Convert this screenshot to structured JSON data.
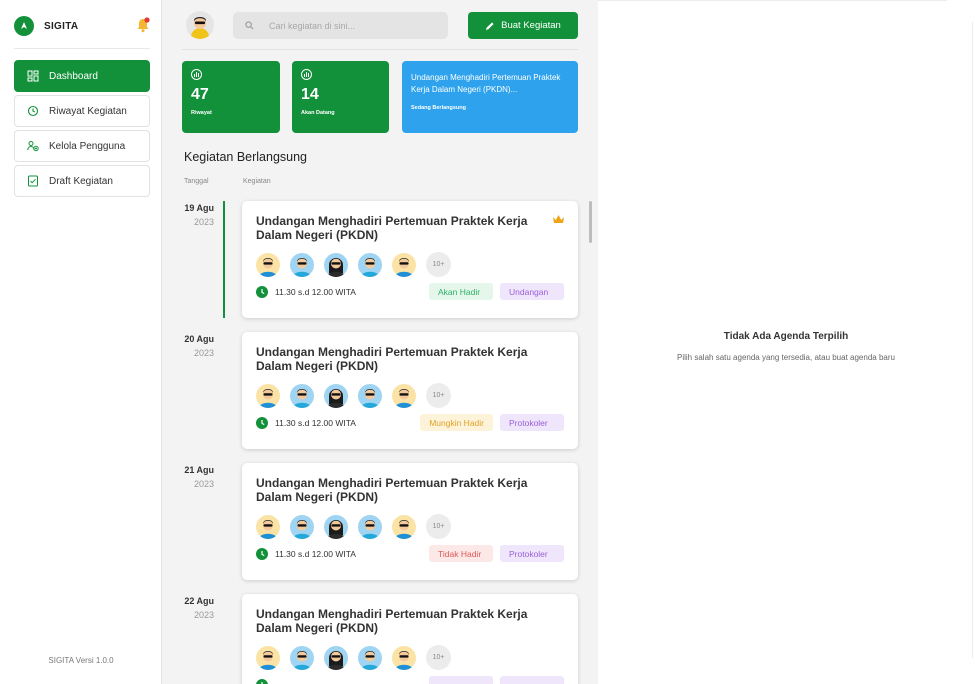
{
  "app": {
    "name": "SIGITA",
    "version_label": "SIGITA Versi 1.0.0"
  },
  "sidebar": {
    "items": [
      {
        "label": "Dashboard",
        "icon": "dashboard-icon",
        "active": true
      },
      {
        "label": "Riwayat Kegiatan",
        "icon": "history-icon",
        "active": false
      },
      {
        "label": "Kelola Pengguna",
        "icon": "users-icon",
        "active": false
      },
      {
        "label": "Draft Kegiatan",
        "icon": "draft-icon",
        "active": false
      }
    ]
  },
  "header": {
    "search_placeholder": "Cari kegiatan di sini...",
    "create_button": "Buat Kegiatan"
  },
  "stats": {
    "history": {
      "value": "47",
      "label": "Riwayat"
    },
    "upcoming": {
      "value": "14",
      "label": "Akan Datang"
    },
    "ongoing": {
      "title": "Undangan Menghadiri Pertemuan Praktek Kerja Dalam Negeri (PKDN)...",
      "label": "Sedang Berlangsung"
    }
  },
  "section": {
    "title": "Kegiatan Berlangsung",
    "col_date": "Tanggal",
    "col_activity": "Kegiatan"
  },
  "activities": [
    {
      "date": "19 Agu",
      "year": "2023",
      "title": "Undangan Menghadiri Pertemuan Praktek Kerja Dalam Negeri (PKDN)",
      "time": "11.30 s.d 12.00 WITA",
      "status": "Akan Hadir",
      "status_color": "green",
      "category": "Undangan",
      "extra": "10+",
      "active": true,
      "starred": true
    },
    {
      "date": "20 Agu",
      "year": "2023",
      "title": "Undangan Menghadiri Pertemuan Praktek Kerja Dalam Negeri (PKDN)",
      "time": "11.30 s.d 12.00 WITA",
      "status": "Mungkin Hadir",
      "status_color": "yellow",
      "category": "Protokoler",
      "extra": "10+",
      "active": false,
      "starred": false
    },
    {
      "date": "21 Agu",
      "year": "2023",
      "title": "Undangan Menghadiri Pertemuan Praktek Kerja Dalam Negeri (PKDN)",
      "time": "11.30 s.d 12.00 WITA",
      "status": "Tidak Hadir",
      "status_color": "red",
      "category": "Protokoler",
      "extra": "10+",
      "active": false,
      "starred": false
    },
    {
      "date": "22 Agu",
      "year": "2023",
      "title": "Undangan Menghadiri Pertemuan Praktek Kerja Dalam Negeri (PKDN)",
      "time": "",
      "status": "",
      "status_color": "purple",
      "category": "",
      "extra": "10+",
      "active": false,
      "starred": false
    }
  ],
  "empty_state": {
    "title": "Tidak Ada Agenda Terpilih",
    "subtitle": "Pilih salah satu agenda yang tersedia, atau buat agenda baru"
  }
}
